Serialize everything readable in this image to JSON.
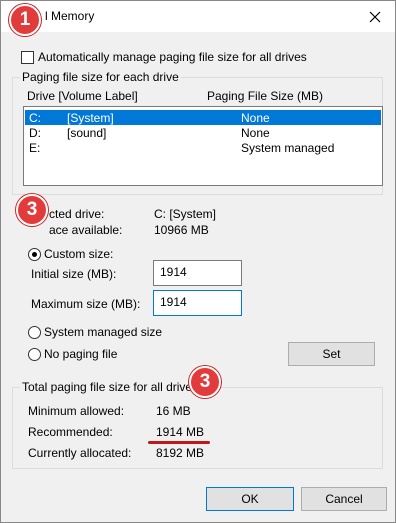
{
  "window": {
    "title": "l Memory",
    "close_icon": "close-icon"
  },
  "auto_manage": {
    "label": "Automatically manage paging file size for all drives",
    "checked": false
  },
  "paging_group": {
    "label": "Paging file size for each drive",
    "columns": [
      "Drive  [Volume Label]",
      "Paging File Size (MB)"
    ],
    "drives": [
      {
        "drive": "C:",
        "volume": "[System]",
        "size": "None",
        "selected": true
      },
      {
        "drive": "D:",
        "volume": "[sound]",
        "size": "None",
        "selected": false
      },
      {
        "drive": "E:",
        "volume": "",
        "size": "System managed",
        "selected": false
      }
    ]
  },
  "selected_info": {
    "drive_label": "cted drive:",
    "drive_value": "C:  [System]",
    "space_label": "ace available:",
    "space_value": "10966 MB"
  },
  "options": {
    "custom_label": "Custom size:",
    "initial_label": "Initial size (MB):",
    "initial_value": "1914",
    "maximum_label": "Maximum size (MB):",
    "maximum_value": "1914",
    "system_managed_label": "System managed size",
    "no_paging_label": "No paging file",
    "set_label": "Set",
    "selected": "custom"
  },
  "total_group": {
    "label": "Total paging file size for all drive",
    "minimum_label": "Minimum allowed:",
    "minimum_value": "16 MB",
    "recommended_label": "Recommended:",
    "recommended_value": "1914 MB",
    "allocated_label": "Currently allocated:",
    "allocated_value": "8192 MB"
  },
  "footer": {
    "ok_label": "OK",
    "cancel_label": "Cancel"
  },
  "annotations": {
    "badge_1": "1",
    "badge_3a": "3",
    "badge_3b": "3",
    "badge_color": "#e23b3b"
  }
}
